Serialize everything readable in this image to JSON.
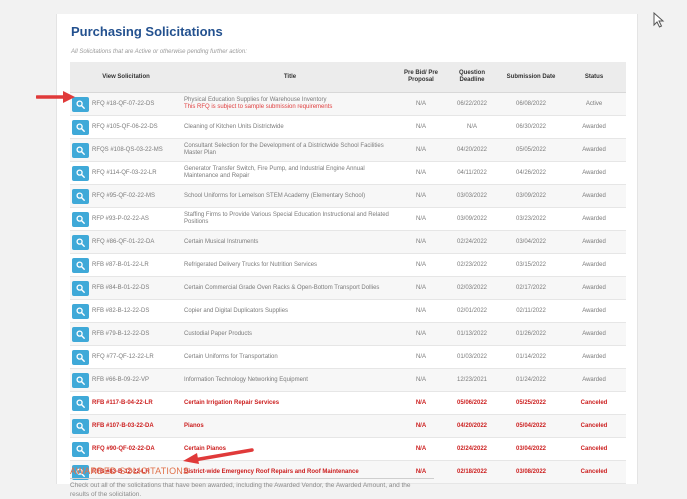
{
  "page": {
    "heading": "Purchasing Solicitations",
    "subtitle": "All Solicitations that are Active or otherwise pending further action:"
  },
  "table": {
    "headers": [
      "View Solicitation",
      "Title",
      "Pre Bid/ Pre Proposal",
      "Question Deadline",
      "Submission Date",
      "Status"
    ],
    "rows": [
      {
        "sol": "RFQ #18-QF-07-22-DS",
        "title": "Physical Education Supplies for Warehouse Inventory",
        "note": "This RFQ is subject to sample submission requirements",
        "pre": "N/A",
        "q": "06/22/2022",
        "sub": "06/08/2022",
        "status": "Active",
        "cancel": false
      },
      {
        "sol": "RFQ #105-QF-06-22-DS",
        "title": "Cleaning of Kitchen Units Districtwide",
        "pre": "N/A",
        "q": "N/A",
        "sub": "06/30/2022",
        "status": "Awarded",
        "cancel": false
      },
      {
        "sol": "RFQS #108-QS-03-22-MS",
        "title": "Consultant Selection for the Development of a Districtwide School Facilities Master Plan",
        "pre": "N/A",
        "q": "04/20/2022",
        "sub": "05/05/2022",
        "status": "Awarded",
        "cancel": false
      },
      {
        "sol": "RFQ #114-QF-03-22-LR",
        "title": "Generator Transfer Switch, Fire Pump, and Industrial Engine Annual Maintenance and Repair",
        "pre": "N/A",
        "q": "04/11/2022",
        "sub": "04/26/2022",
        "status": "Awarded",
        "cancel": false
      },
      {
        "sol": "RFQ #95-QF-02-22-MS",
        "title": "School Uniforms for Lemelson STEM Academy (Elementary School)",
        "pre": "N/A",
        "q": "03/03/2022",
        "sub": "03/09/2022",
        "status": "Awarded",
        "cancel": false
      },
      {
        "sol": "RFP #93-P-02-22-AS",
        "title": "Staffing Firms to Provide Various Special Education Instructional and Related Positions",
        "pre": "N/A",
        "q": "03/09/2022",
        "sub": "03/23/2022",
        "status": "Awarded",
        "cancel": false
      },
      {
        "sol": "RFQ #86-QF-01-22-DA",
        "title": "Certain Musical Instruments",
        "pre": "N/A",
        "q": "02/24/2022",
        "sub": "03/04/2022",
        "status": "Awarded",
        "cancel": false
      },
      {
        "sol": "RFB #87-B-01-22-LR",
        "title": "Refrigerated Delivery Trucks for Nutrition Services",
        "pre": "N/A",
        "q": "02/23/2022",
        "sub": "03/15/2022",
        "status": "Awarded",
        "cancel": false
      },
      {
        "sol": "RFB #84-B-01-22-DS",
        "title": "Certain Commercial Grade Oven Racks & Open-Bottom Transport Dollies",
        "pre": "N/A",
        "q": "02/03/2022",
        "sub": "02/17/2022",
        "status": "Awarded",
        "cancel": false
      },
      {
        "sol": "RFB #82-B-12-22-DS",
        "title": "Copier and Digital Duplicators Supplies",
        "pre": "N/A",
        "q": "02/01/2022",
        "sub": "02/11/2022",
        "status": "Awarded",
        "cancel": false
      },
      {
        "sol": "RFB #79-B-12-22-DS",
        "title": "Custodial Paper Products",
        "pre": "N/A",
        "q": "01/13/2022",
        "sub": "01/26/2022",
        "status": "Awarded",
        "cancel": false
      },
      {
        "sol": "RFQ #77-QF-12-22-LR",
        "title": "Certain Uniforms for Transportation",
        "pre": "N/A",
        "q": "01/03/2022",
        "sub": "01/14/2022",
        "status": "Awarded",
        "cancel": false
      },
      {
        "sol": "RFB #66-B-09-22-VP",
        "title": "Information Technology Networking Equipment",
        "pre": "N/A",
        "q": "12/23/2021",
        "sub": "01/24/2022",
        "status": "Awarded",
        "cancel": false
      },
      {
        "sol": "RFB #117-B-04-22-LR",
        "title": "Certain Irrigation Repair Services",
        "pre": "N/A",
        "q": "05/06/2022",
        "sub": "05/25/2022",
        "status": "Canceled",
        "cancel": true
      },
      {
        "sol": "RFB #107-B-03-22-DA",
        "title": "Pianos",
        "pre": "N/A",
        "q": "04/20/2022",
        "sub": "05/04/2022",
        "status": "Canceled",
        "cancel": true
      },
      {
        "sol": "RFQ #90-QF-02-22-DA",
        "title": "Certain Pianos",
        "pre": "N/A",
        "q": "02/24/2022",
        "sub": "03/04/2022",
        "status": "Canceled",
        "cancel": true
      },
      {
        "sol": "RFB #83-B-12-22-LR",
        "title": "District-wide Emergency Roof Repairs and Roof Maintenance",
        "pre": "N/A",
        "q": "02/18/2022",
        "sub": "03/08/2022",
        "status": "Canceled",
        "cancel": true
      }
    ]
  },
  "awarded": {
    "heading": "AWARDED SOLICITATIONS",
    "desc": "Check out all of the solicitations that have been awarded, including the Awarded Vendor, the Awarded Amount, and the results of the solicitation."
  },
  "icons": {
    "view": "search-icon",
    "annotation": "red-arrow-icon",
    "cursor": "mouse-pointer-icon"
  },
  "colors": {
    "heading": "#23518f",
    "button": "#3fa9d8",
    "canceled": "#cc1f1f",
    "awarded_heading": "#e0714a",
    "arrow": "#e03a3a"
  }
}
